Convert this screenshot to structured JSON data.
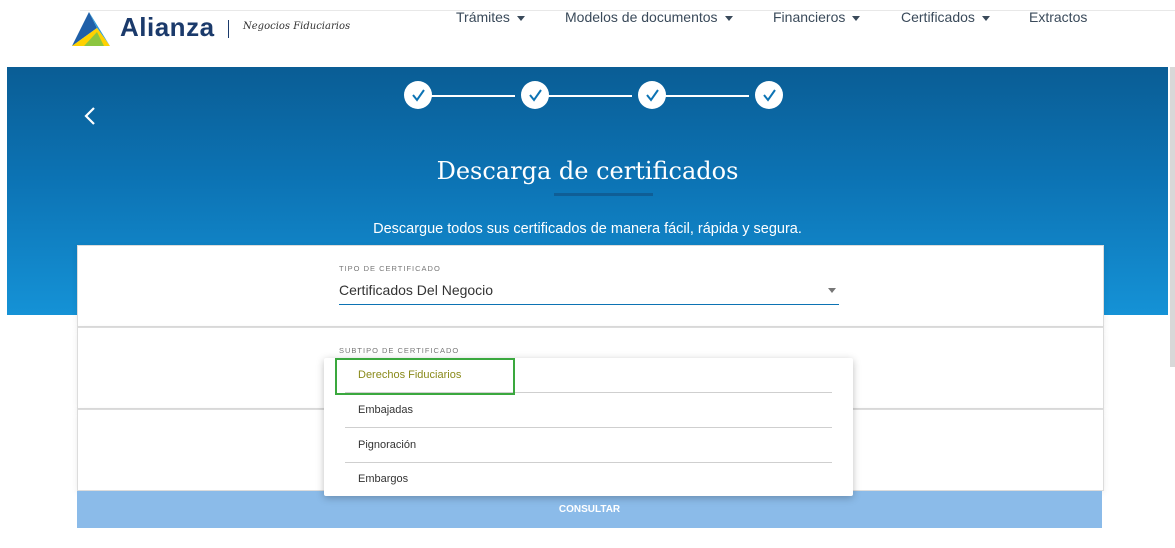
{
  "header": {
    "brand": "Alianza",
    "subtitle": "Negocios Fiduciarios",
    "nav": [
      "Trámites",
      "Modelos de documentos",
      "Financieros",
      "Certificados",
      "Extractos"
    ]
  },
  "hero": {
    "title": "Descarga de certificados",
    "subtitle": "Descargue todos sus certificados de manera fácil, rápida y segura.",
    "steps_completed": 4
  },
  "form": {
    "tipo_label": "TIPO DE CERTIFICADO",
    "tipo_value": "Certificados Del Negocio",
    "subtipo_label": "SUBTIPO DE CERTIFICADO",
    "submit_label": "CONSULTAR"
  },
  "dropdown": {
    "options": [
      "Derechos Fiduciarios",
      "Embajadas",
      "Pignoración",
      "Embargos"
    ],
    "selected_index": 0
  },
  "colors": {
    "brand_navy": "#1b3a6b",
    "hero_blue": "#0c73b4",
    "selected_option": "#8a8a1a",
    "highlight_green": "#3aa83e",
    "button_blue": "#8bbbe9"
  },
  "icons": [
    "alianza-logo-icon",
    "back-chevron-icon",
    "check-icon",
    "caret-down-icon"
  ]
}
